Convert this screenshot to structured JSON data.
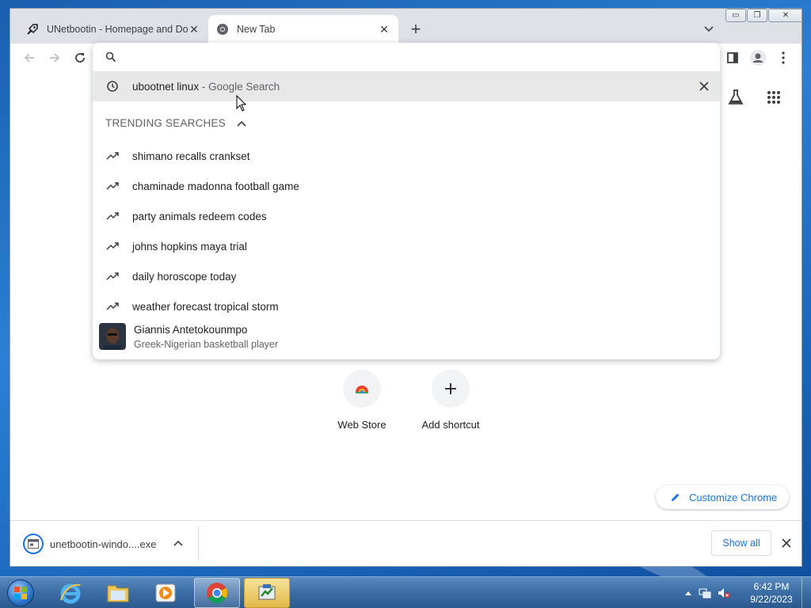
{
  "browser": {
    "tabs": [
      {
        "title": "UNetbootin - Homepage and Do",
        "icon": "unetbootin-favicon",
        "active": false
      },
      {
        "title": "New Tab",
        "icon": "chrome-favicon",
        "active": true
      }
    ],
    "new_tab_symbol": "+",
    "window_controls": {
      "minimize": "▭",
      "restore": "❐",
      "close": "✕"
    }
  },
  "omnibox": {
    "input_value": "",
    "top_suggestion": {
      "query": "ubootnet linux",
      "suffix": " - Google Search"
    },
    "trending_header": "TRENDING SEARCHES",
    "trending": [
      "shimano recalls crankset",
      "chaminade madonna football game",
      "party animals redeem codes",
      "johns hopkins maya trial",
      "daily horoscope today",
      "weather forecast tropical storm"
    ],
    "entity": {
      "title": "Giannis Antetokounmpo",
      "subtitle": "Greek-Nigerian basketball player"
    }
  },
  "new_tab_page": {
    "shortcuts": [
      {
        "label": "Web Store",
        "icon": "webstore-icon"
      },
      {
        "label": "Add shortcut",
        "icon": "plus-icon"
      }
    ],
    "customize_label": "Customize Chrome"
  },
  "download_bar": {
    "file_name": "unetbootin-windo....exe",
    "show_all_label": "Show all"
  },
  "taskbar": {
    "apps": [
      "internet-explorer",
      "windows-explorer",
      "media-player",
      "chrome",
      "unetbootin"
    ],
    "time": "6:42 PM",
    "date": "9/22/2023"
  },
  "colors": {
    "accent": "#1a73e8",
    "tab_strip": "#dee1e6",
    "highlight_row": "#e8e8e9"
  }
}
